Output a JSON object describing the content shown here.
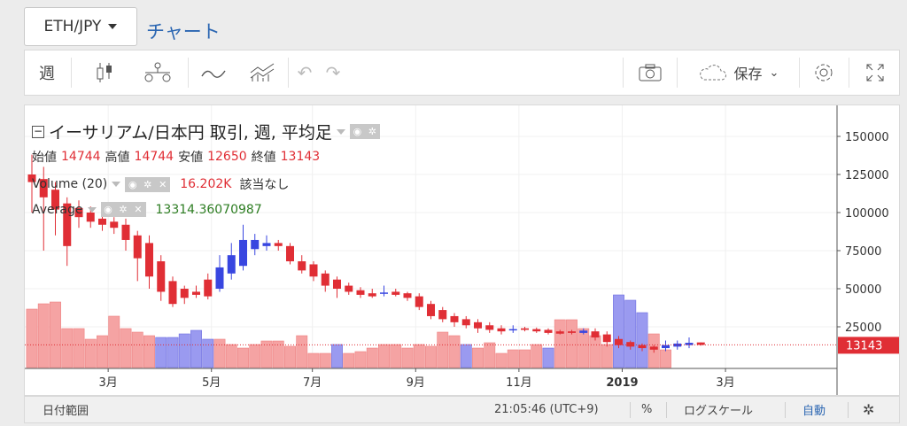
{
  "pair": "ETH/JPY",
  "chart_link": "チャート",
  "toolbar": {
    "interval": "週",
    "save_label": "保存"
  },
  "legend": {
    "title": "イーサリアム/日本円 取引, 週, 平均足",
    "ohlc": {
      "open_label": "始値",
      "open": "14744",
      "high_label": "高値",
      "high": "14744",
      "low_label": "安値",
      "low": "12650",
      "close_label": "終値",
      "close": "13143"
    },
    "volume": {
      "label": "Volume (20)",
      "value": "16.202K",
      "extra": "該当なし"
    },
    "average": {
      "label": "Average",
      "value": "13314.36070987"
    }
  },
  "price_label": "13143",
  "bottom": {
    "date_range": "日付範囲",
    "time": "21:05:46 (UTC+9)",
    "percent": "%",
    "log_scale": "ログスケール",
    "auto": "自動"
  },
  "colors": {
    "up": "#e02e35",
    "down": "#3846e0",
    "volume_up": "#f5a3a3",
    "volume_down": "#9a9af0",
    "link": "#2b66b2"
  },
  "chart_data": {
    "type": "candlestick",
    "title": "イーサリアム/日本円 取引, 週, 平均足",
    "y_ticks": [
      25000,
      50000,
      75000,
      100000,
      125000,
      150000
    ],
    "y_tick_labels": [
      "25000",
      "50000",
      "75000",
      "100000",
      "125000",
      "150000"
    ],
    "ylim": [
      0,
      165000
    ],
    "x_tick_labels": [
      "3月",
      "5月",
      "7月",
      "9月",
      "11月",
      "2019",
      "3月"
    ],
    "x_tick_weeks": [
      6.5,
      15.3,
      23.9,
      32.7,
      41.5,
      50.3,
      59.1
    ],
    "last_price": 13143,
    "candles": [
      {
        "o": 125000,
        "c": 120000,
        "h": 138000,
        "l": 100000,
        "d": false
      },
      {
        "o": 122000,
        "c": 110000,
        "h": 130000,
        "l": 75000,
        "d": false
      },
      {
        "o": 115000,
        "c": 102000,
        "h": 120000,
        "l": 85000,
        "d": false
      },
      {
        "o": 106000,
        "c": 78000,
        "h": 110000,
        "l": 65000,
        "d": false
      },
      {
        "o": 103000,
        "c": 97000,
        "h": 108000,
        "l": 90000,
        "d": false
      },
      {
        "o": 100000,
        "c": 94000,
        "h": 104000,
        "l": 90000,
        "d": false
      },
      {
        "o": 96000,
        "c": 92000,
        "h": 100000,
        "l": 88000,
        "d": false
      },
      {
        "o": 94000,
        "c": 90000,
        "h": 97000,
        "l": 86000,
        "d": false
      },
      {
        "o": 92000,
        "c": 82000,
        "h": 96000,
        "l": 75000,
        "d": false
      },
      {
        "o": 85000,
        "c": 70000,
        "h": 88000,
        "l": 55000,
        "d": false
      },
      {
        "o": 80000,
        "c": 58000,
        "h": 85000,
        "l": 50000,
        "d": false
      },
      {
        "o": 68000,
        "c": 48000,
        "h": 72000,
        "l": 42000,
        "d": false
      },
      {
        "o": 55000,
        "c": 40000,
        "h": 58000,
        "l": 38000,
        "d": false
      },
      {
        "o": 50000,
        "c": 44000,
        "h": 52000,
        "l": 40000,
        "d": false
      },
      {
        "o": 46000,
        "c": 48000,
        "h": 52000,
        "l": 44000,
        "d": false
      },
      {
        "o": 56000,
        "c": 45000,
        "h": 60000,
        "l": 43000,
        "d": false
      },
      {
        "o": 50000,
        "c": 64000,
        "h": 72000,
        "l": 48000,
        "d": true
      },
      {
        "o": 60000,
        "c": 72000,
        "h": 80000,
        "l": 56000,
        "d": true
      },
      {
        "o": 65000,
        "c": 82000,
        "h": 92000,
        "l": 62000,
        "d": true
      },
      {
        "o": 76000,
        "c": 82000,
        "h": 86000,
        "l": 72000,
        "d": true
      },
      {
        "o": 78000,
        "c": 80000,
        "h": 85000,
        "l": 75000,
        "d": true
      },
      {
        "o": 80000,
        "c": 78000,
        "h": 82000,
        "l": 75000,
        "d": false
      },
      {
        "o": 78000,
        "c": 68000,
        "h": 80000,
        "l": 66000,
        "d": false
      },
      {
        "o": 68000,
        "c": 62000,
        "h": 72000,
        "l": 60000,
        "d": false
      },
      {
        "o": 66000,
        "c": 58000,
        "h": 68000,
        "l": 55000,
        "d": false
      },
      {
        "o": 60000,
        "c": 52000,
        "h": 62000,
        "l": 48000,
        "d": false
      },
      {
        "o": 56000,
        "c": 50000,
        "h": 58000,
        "l": 44000,
        "d": false
      },
      {
        "o": 52000,
        "c": 48000,
        "h": 54000,
        "l": 46000,
        "d": false
      },
      {
        "o": 49000,
        "c": 46000,
        "h": 51000,
        "l": 44000,
        "d": false
      },
      {
        "o": 47000,
        "c": 45000,
        "h": 50000,
        "l": 44000,
        "d": false
      },
      {
        "o": 47000,
        "c": 47500,
        "h": 52000,
        "l": 45000,
        "d": true
      },
      {
        "o": 48000,
        "c": 46000,
        "h": 50000,
        "l": 45000,
        "d": false
      },
      {
        "o": 47000,
        "c": 44000,
        "h": 48000,
        "l": 42000,
        "d": false
      },
      {
        "o": 45000,
        "c": 38000,
        "h": 47000,
        "l": 36000,
        "d": false
      },
      {
        "o": 40000,
        "c": 32000,
        "h": 42000,
        "l": 30000,
        "d": false
      },
      {
        "o": 36000,
        "c": 30000,
        "h": 38000,
        "l": 28000,
        "d": false
      },
      {
        "o": 32000,
        "c": 28000,
        "h": 34000,
        "l": 25000,
        "d": false
      },
      {
        "o": 30000,
        "c": 26000,
        "h": 32000,
        "l": 24000,
        "d": false
      },
      {
        "o": 28000,
        "c": 24000,
        "h": 30000,
        "l": 21000,
        "d": false
      },
      {
        "o": 26000,
        "c": 23000,
        "h": 28000,
        "l": 21000,
        "d": false
      },
      {
        "o": 24000,
        "c": 22000,
        "h": 26000,
        "l": 20000,
        "d": false
      },
      {
        "o": 23000,
        "c": 23500,
        "h": 26000,
        "l": 21000,
        "d": true
      },
      {
        "o": 24000,
        "c": 23000,
        "h": 25000,
        "l": 22000,
        "d": false
      },
      {
        "o": 23500,
        "c": 22000,
        "h": 24500,
        "l": 21000,
        "d": false
      },
      {
        "o": 23000,
        "c": 21000,
        "h": 24000,
        "l": 20000,
        "d": false
      },
      {
        "o": 22000,
        "c": 20500,
        "h": 23000,
        "l": 20000,
        "d": false
      },
      {
        "o": 22000,
        "c": 21000,
        "h": 23000,
        "l": 20000,
        "d": false
      },
      {
        "o": 21000,
        "c": 22500,
        "h": 24000,
        "l": 20000,
        "d": true
      },
      {
        "o": 22000,
        "c": 18000,
        "h": 24000,
        "l": 16000,
        "d": false
      },
      {
        "o": 20000,
        "c": 15000,
        "h": 22000,
        "l": 12000,
        "d": false
      },
      {
        "o": 17000,
        "c": 13000,
        "h": 19000,
        "l": 11000,
        "d": false
      },
      {
        "o": 15000,
        "c": 12000,
        "h": 16000,
        "l": 10000,
        "d": false
      },
      {
        "o": 13000,
        "c": 11000,
        "h": 14000,
        "l": 9000,
        "d": false
      },
      {
        "o": 12000,
        "c": 10000,
        "h": 13000,
        "l": 8000,
        "d": false
      },
      {
        "o": 11000,
        "c": 13000,
        "h": 16000,
        "l": 9000,
        "d": true
      },
      {
        "o": 12000,
        "c": 14000,
        "h": 16000,
        "l": 10000,
        "d": true
      },
      {
        "o": 13000,
        "c": 14500,
        "h": 18000,
        "l": 11000,
        "d": true
      },
      {
        "o": 14744,
        "c": 13143,
        "h": 14744,
        "l": 12650,
        "d": false
      }
    ],
    "volumes": [
      {
        "v": 33000,
        "d": false
      },
      {
        "v": 36000,
        "d": false
      },
      {
        "v": 37000,
        "d": false
      },
      {
        "v": 22000,
        "d": false
      },
      {
        "v": 22000,
        "d": false
      },
      {
        "v": 16000,
        "d": false
      },
      {
        "v": 18000,
        "d": false
      },
      {
        "v": 29000,
        "d": false
      },
      {
        "v": 22000,
        "d": false
      },
      {
        "v": 20000,
        "d": false
      },
      {
        "v": 18000,
        "d": false
      },
      {
        "v": 17000,
        "d": true
      },
      {
        "v": 17000,
        "d": true
      },
      {
        "v": 19000,
        "d": true
      },
      {
        "v": 21000,
        "d": true
      },
      {
        "v": 16000,
        "d": true
      },
      {
        "v": 16000,
        "d": false
      },
      {
        "v": 13000,
        "d": false
      },
      {
        "v": 11000,
        "d": false
      },
      {
        "v": 13000,
        "d": false
      },
      {
        "v": 15000,
        "d": false
      },
      {
        "v": 15000,
        "d": false
      },
      {
        "v": 12000,
        "d": false
      },
      {
        "v": 18000,
        "d": false
      },
      {
        "v": 8000,
        "d": false
      },
      {
        "v": 8000,
        "d": false
      },
      {
        "v": 13000,
        "d": true
      },
      {
        "v": 8000,
        "d": false
      },
      {
        "v": 9000,
        "d": false
      },
      {
        "v": 11000,
        "d": false
      },
      {
        "v": 13000,
        "d": false
      },
      {
        "v": 13000,
        "d": false
      },
      {
        "v": 11000,
        "d": false
      },
      {
        "v": 13000,
        "d": false
      },
      {
        "v": 12000,
        "d": false
      },
      {
        "v": 20000,
        "d": false
      },
      {
        "v": 18000,
        "d": false
      },
      {
        "v": 13000,
        "d": true
      },
      {
        "v": 11000,
        "d": false
      },
      {
        "v": 14000,
        "d": false
      },
      {
        "v": 8000,
        "d": false
      },
      {
        "v": 10000,
        "d": false
      },
      {
        "v": 10000,
        "d": false
      },
      {
        "v": 13000,
        "d": false
      },
      {
        "v": 11000,
        "d": true
      },
      {
        "v": 27000,
        "d": false
      },
      {
        "v": 27000,
        "d": false
      },
      {
        "v": 22000,
        "d": false
      },
      {
        "v": 18000,
        "d": false
      },
      {
        "v": 13000,
        "d": false
      },
      {
        "v": 41000,
        "d": true
      },
      {
        "v": 38000,
        "d": true
      },
      {
        "v": 31000,
        "d": true
      },
      {
        "v": 19000,
        "d": false
      },
      {
        "v": 10000,
        "d": false
      }
    ],
    "volume_max": 50000
  }
}
